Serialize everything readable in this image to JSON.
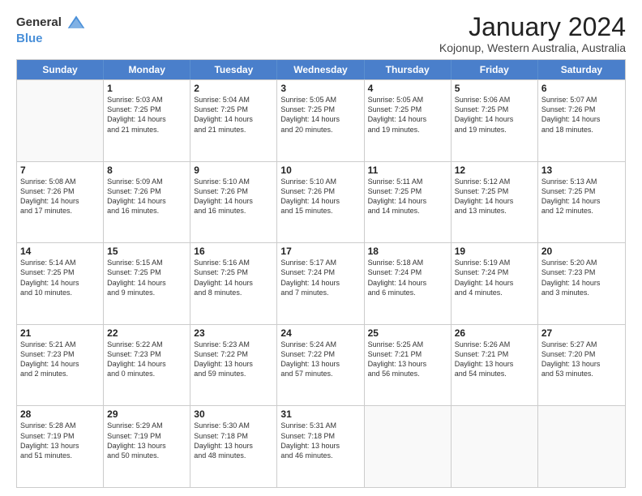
{
  "logo": {
    "general": "General",
    "blue": "Blue"
  },
  "title": "January 2024",
  "location": "Kojonup, Western Australia, Australia",
  "header": {
    "days": [
      "Sunday",
      "Monday",
      "Tuesday",
      "Wednesday",
      "Thursday",
      "Friday",
      "Saturday"
    ]
  },
  "rows": [
    [
      {
        "day": "",
        "empty": true
      },
      {
        "day": "1",
        "lines": [
          "Sunrise: 5:03 AM",
          "Sunset: 7:25 PM",
          "Daylight: 14 hours",
          "and 21 minutes."
        ]
      },
      {
        "day": "2",
        "lines": [
          "Sunrise: 5:04 AM",
          "Sunset: 7:25 PM",
          "Daylight: 14 hours",
          "and 21 minutes."
        ]
      },
      {
        "day": "3",
        "lines": [
          "Sunrise: 5:05 AM",
          "Sunset: 7:25 PM",
          "Daylight: 14 hours",
          "and 20 minutes."
        ]
      },
      {
        "day": "4",
        "lines": [
          "Sunrise: 5:05 AM",
          "Sunset: 7:25 PM",
          "Daylight: 14 hours",
          "and 19 minutes."
        ]
      },
      {
        "day": "5",
        "lines": [
          "Sunrise: 5:06 AM",
          "Sunset: 7:25 PM",
          "Daylight: 14 hours",
          "and 19 minutes."
        ]
      },
      {
        "day": "6",
        "lines": [
          "Sunrise: 5:07 AM",
          "Sunset: 7:26 PM",
          "Daylight: 14 hours",
          "and 18 minutes."
        ]
      }
    ],
    [
      {
        "day": "7",
        "lines": [
          "Sunrise: 5:08 AM",
          "Sunset: 7:26 PM",
          "Daylight: 14 hours",
          "and 17 minutes."
        ]
      },
      {
        "day": "8",
        "lines": [
          "Sunrise: 5:09 AM",
          "Sunset: 7:26 PM",
          "Daylight: 14 hours",
          "and 16 minutes."
        ]
      },
      {
        "day": "9",
        "lines": [
          "Sunrise: 5:10 AM",
          "Sunset: 7:26 PM",
          "Daylight: 14 hours",
          "and 16 minutes."
        ]
      },
      {
        "day": "10",
        "lines": [
          "Sunrise: 5:10 AM",
          "Sunset: 7:26 PM",
          "Daylight: 14 hours",
          "and 15 minutes."
        ]
      },
      {
        "day": "11",
        "lines": [
          "Sunrise: 5:11 AM",
          "Sunset: 7:25 PM",
          "Daylight: 14 hours",
          "and 14 minutes."
        ]
      },
      {
        "day": "12",
        "lines": [
          "Sunrise: 5:12 AM",
          "Sunset: 7:25 PM",
          "Daylight: 14 hours",
          "and 13 minutes."
        ]
      },
      {
        "day": "13",
        "lines": [
          "Sunrise: 5:13 AM",
          "Sunset: 7:25 PM",
          "Daylight: 14 hours",
          "and 12 minutes."
        ]
      }
    ],
    [
      {
        "day": "14",
        "lines": [
          "Sunrise: 5:14 AM",
          "Sunset: 7:25 PM",
          "Daylight: 14 hours",
          "and 10 minutes."
        ]
      },
      {
        "day": "15",
        "lines": [
          "Sunrise: 5:15 AM",
          "Sunset: 7:25 PM",
          "Daylight: 14 hours",
          "and 9 minutes."
        ]
      },
      {
        "day": "16",
        "lines": [
          "Sunrise: 5:16 AM",
          "Sunset: 7:25 PM",
          "Daylight: 14 hours",
          "and 8 minutes."
        ]
      },
      {
        "day": "17",
        "lines": [
          "Sunrise: 5:17 AM",
          "Sunset: 7:24 PM",
          "Daylight: 14 hours",
          "and 7 minutes."
        ]
      },
      {
        "day": "18",
        "lines": [
          "Sunrise: 5:18 AM",
          "Sunset: 7:24 PM",
          "Daylight: 14 hours",
          "and 6 minutes."
        ]
      },
      {
        "day": "19",
        "lines": [
          "Sunrise: 5:19 AM",
          "Sunset: 7:24 PM",
          "Daylight: 14 hours",
          "and 4 minutes."
        ]
      },
      {
        "day": "20",
        "lines": [
          "Sunrise: 5:20 AM",
          "Sunset: 7:23 PM",
          "Daylight: 14 hours",
          "and 3 minutes."
        ]
      }
    ],
    [
      {
        "day": "21",
        "lines": [
          "Sunrise: 5:21 AM",
          "Sunset: 7:23 PM",
          "Daylight: 14 hours",
          "and 2 minutes."
        ]
      },
      {
        "day": "22",
        "lines": [
          "Sunrise: 5:22 AM",
          "Sunset: 7:23 PM",
          "Daylight: 14 hours",
          "and 0 minutes."
        ]
      },
      {
        "day": "23",
        "lines": [
          "Sunrise: 5:23 AM",
          "Sunset: 7:22 PM",
          "Daylight: 13 hours",
          "and 59 minutes."
        ]
      },
      {
        "day": "24",
        "lines": [
          "Sunrise: 5:24 AM",
          "Sunset: 7:22 PM",
          "Daylight: 13 hours",
          "and 57 minutes."
        ]
      },
      {
        "day": "25",
        "lines": [
          "Sunrise: 5:25 AM",
          "Sunset: 7:21 PM",
          "Daylight: 13 hours",
          "and 56 minutes."
        ]
      },
      {
        "day": "26",
        "lines": [
          "Sunrise: 5:26 AM",
          "Sunset: 7:21 PM",
          "Daylight: 13 hours",
          "and 54 minutes."
        ]
      },
      {
        "day": "27",
        "lines": [
          "Sunrise: 5:27 AM",
          "Sunset: 7:20 PM",
          "Daylight: 13 hours",
          "and 53 minutes."
        ]
      }
    ],
    [
      {
        "day": "28",
        "lines": [
          "Sunrise: 5:28 AM",
          "Sunset: 7:19 PM",
          "Daylight: 13 hours",
          "and 51 minutes."
        ]
      },
      {
        "day": "29",
        "lines": [
          "Sunrise: 5:29 AM",
          "Sunset: 7:19 PM",
          "Daylight: 13 hours",
          "and 50 minutes."
        ]
      },
      {
        "day": "30",
        "lines": [
          "Sunrise: 5:30 AM",
          "Sunset: 7:18 PM",
          "Daylight: 13 hours",
          "and 48 minutes."
        ]
      },
      {
        "day": "31",
        "lines": [
          "Sunrise: 5:31 AM",
          "Sunset: 7:18 PM",
          "Daylight: 13 hours",
          "and 46 minutes."
        ]
      },
      {
        "day": "",
        "empty": true
      },
      {
        "day": "",
        "empty": true
      },
      {
        "day": "",
        "empty": true
      }
    ]
  ]
}
